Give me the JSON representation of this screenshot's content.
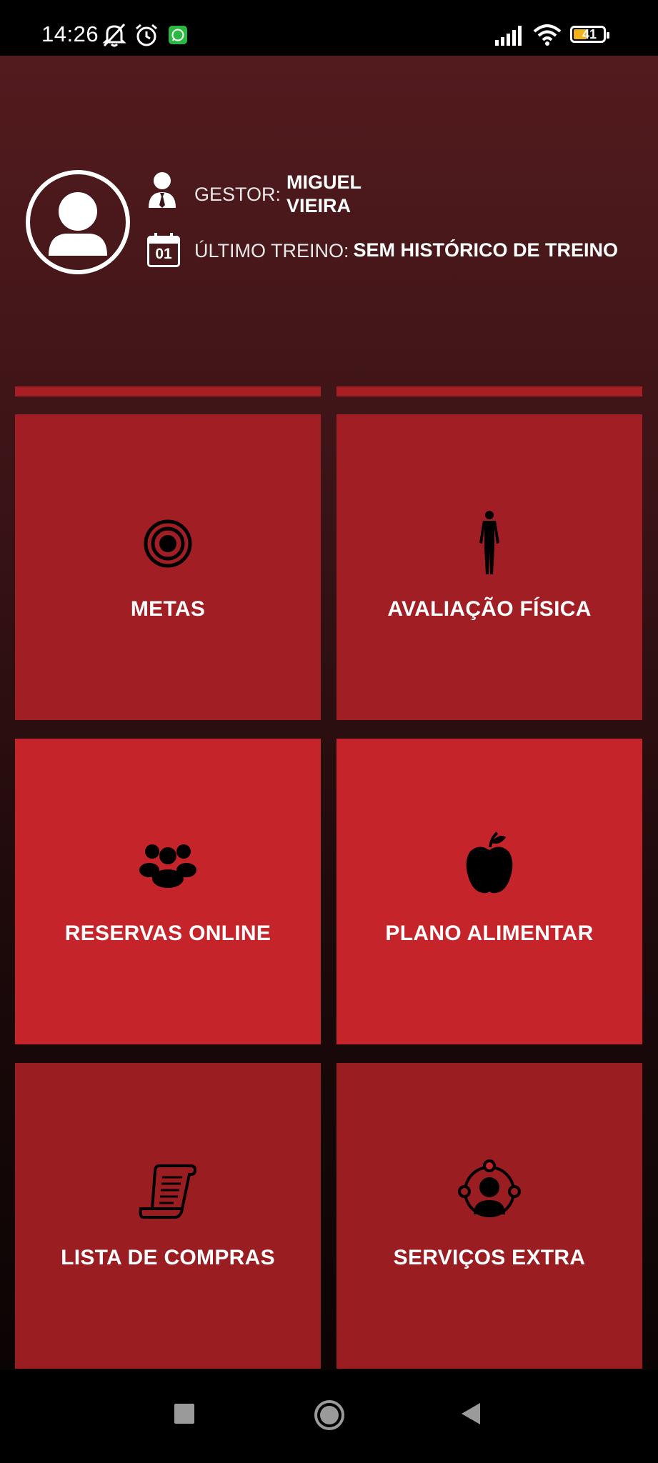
{
  "status_bar": {
    "time": "14:26",
    "battery": "41",
    "icons": [
      "mute-icon",
      "alarm-icon",
      "whatsapp-icon",
      "signal-icon",
      "wifi-icon",
      "battery-icon"
    ]
  },
  "profile": {
    "manager_label": "GESTOR:",
    "manager_name_line1": "MIGUEL",
    "manager_name_line2": "VIEIRA",
    "last_training_label": "ÚLTIMO TREINO:",
    "last_training_value": "SEM HISTÓRICO DE TREINO",
    "calendar_day": "01"
  },
  "tiles": [
    {
      "label": "METAS",
      "icon": "target-icon"
    },
    {
      "label": "AVALIAÇÃO FÍSICA",
      "icon": "body-icon"
    },
    {
      "label": "RESERVAS ONLINE",
      "icon": "group-icon"
    },
    {
      "label": "PLANO ALIMENTAR",
      "icon": "apple-icon"
    },
    {
      "label": "LISTA DE COMPRAS",
      "icon": "scroll-icon"
    },
    {
      "label": "SERVIÇOS EXTRA",
      "icon": "network-icon"
    }
  ],
  "colors": {
    "tile_dark": "#a11f24",
    "tile_bright": "#c5242b",
    "header_top": "#531b1e"
  }
}
